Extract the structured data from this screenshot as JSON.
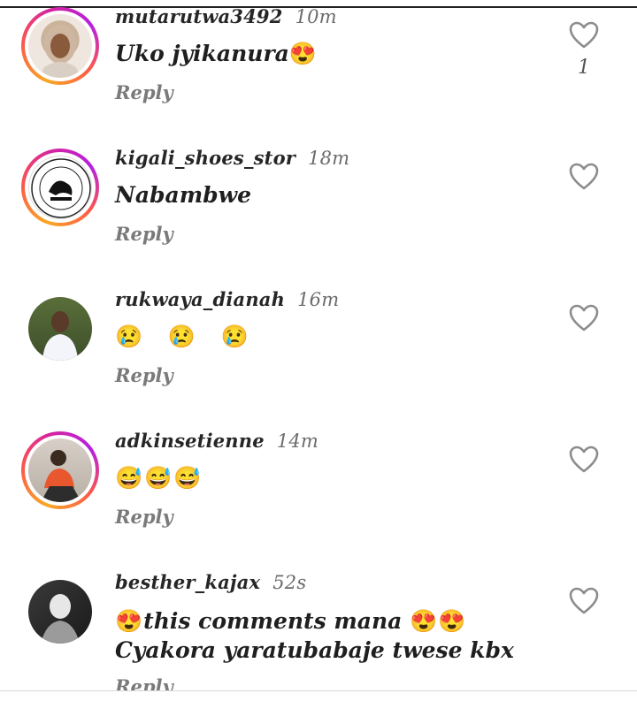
{
  "comments": [
    {
      "username": "mutarutwa3492",
      "time": "10m",
      "text": "Uko jyikanura",
      "emoji": "😍",
      "reply": "Reply",
      "likes": "1"
    },
    {
      "username": "kigali_shoes_stor",
      "time": "18m",
      "text": "Nabambwe",
      "reply": "Reply"
    },
    {
      "username": "rukwaya_dianah",
      "time": "16m",
      "emoji": "😢 😢 😢",
      "reply": "Reply"
    },
    {
      "username": "adkinsetienne",
      "time": "14m",
      "emoji": "😅😅😅",
      "reply": "Reply"
    },
    {
      "username": "besther_kajax",
      "time": "52s",
      "emoji_lead": "😍",
      "text": "this comments mana",
      "emoji_mid": "😍😍",
      "text2": "Cyakora yaratubabaje twese kbx",
      "reply": "Reply"
    }
  ],
  "colors": {
    "story_ring": [
      "#f9a825",
      "#fd5949",
      "#d6249f",
      "#b620e0"
    ],
    "emoji_pink": "#d33ad6",
    "emoji_blue": "#1a3fcf"
  },
  "icons": {
    "like": "heart-outline-icon"
  }
}
